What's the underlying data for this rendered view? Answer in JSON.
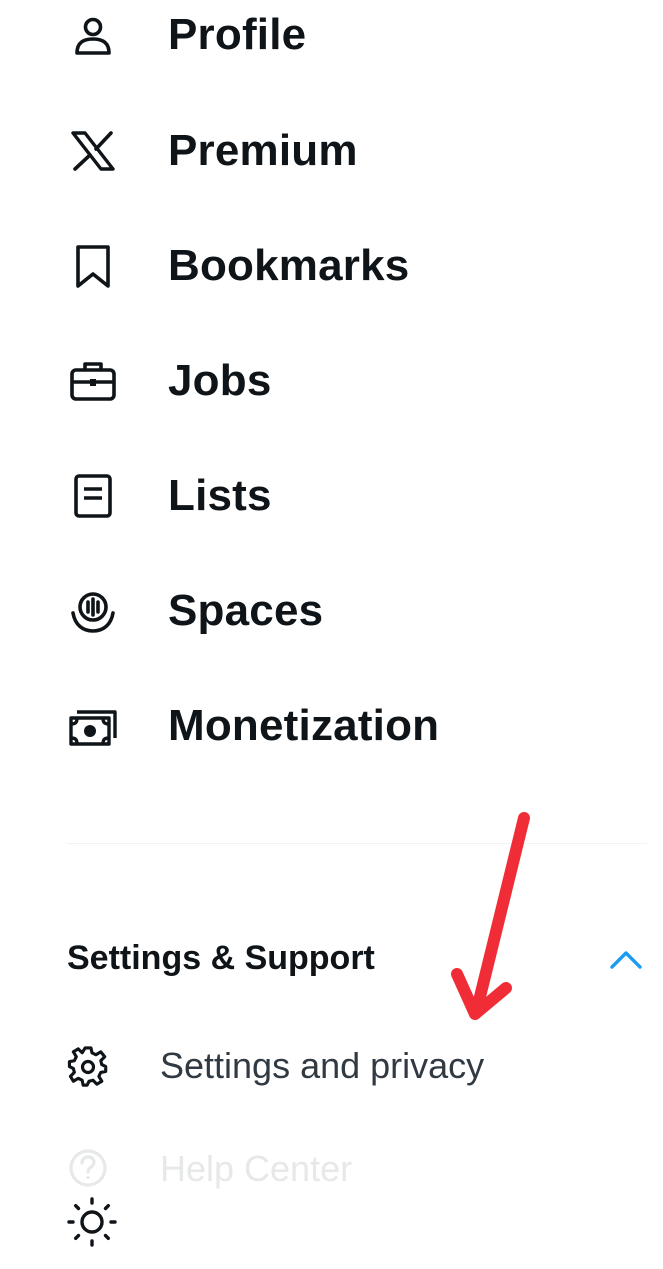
{
  "nav": {
    "items": [
      {
        "label": "Profile",
        "icon": "person-icon"
      },
      {
        "label": "Premium",
        "icon": "x-logo-icon"
      },
      {
        "label": "Bookmarks",
        "icon": "bookmark-icon"
      },
      {
        "label": "Jobs",
        "icon": "briefcase-icon"
      },
      {
        "label": "Lists",
        "icon": "list-icon"
      },
      {
        "label": "Spaces",
        "icon": "microphone-icon"
      },
      {
        "label": "Monetization",
        "icon": "money-icon"
      }
    ]
  },
  "settings_support": {
    "title": "Settings & Support",
    "expanded_icon": "chevron-up-icon",
    "items": [
      {
        "label": "Settings and privacy",
        "icon": "gear-icon"
      },
      {
        "label": "Help Center",
        "icon": "help-circle-icon"
      }
    ],
    "display_icon": "sun-icon"
  },
  "colors": {
    "text_primary": "#0f1419",
    "text_secondary": "#313a42",
    "faded": "#e6e8ea",
    "accent": "#1d9bf0",
    "annotation_arrow": "#f02d36",
    "divider": "#eff3f4"
  },
  "annotation": {
    "type": "red-arrow",
    "points_to": "Settings and privacy"
  }
}
